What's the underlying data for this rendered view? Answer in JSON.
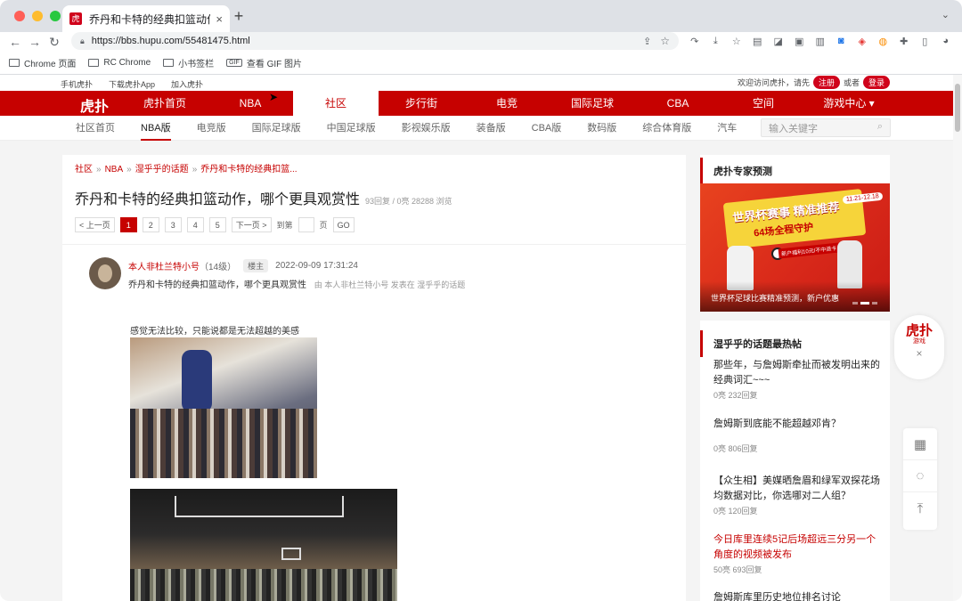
{
  "browser": {
    "tab_title": "乔丹和卡特的经典扣篮动作，",
    "tab_favicon": "虎扑",
    "url": "https://bbs.hupu.com/55481475.html",
    "bookmarks": [
      {
        "label": "Chrome 页面"
      },
      {
        "label": "RC Chrome"
      },
      {
        "label": "小书签栏"
      },
      {
        "label": "查看 GIF 图片",
        "badge": "GIF"
      }
    ]
  },
  "topstrip": {
    "links": [
      "手机虎扑",
      "下载虎扑App",
      "加入虎扑"
    ],
    "welcome": "欢迎访问虎扑，请先",
    "register": "注册",
    "or": "或者",
    "login": "登录"
  },
  "mainnav": {
    "logo": "虎扑",
    "items": [
      "虎扑首页",
      "NBA",
      "社区",
      "步行街",
      "电竞",
      "国际足球",
      "CBA",
      "空间",
      "游戏中心 ▾"
    ],
    "active": "社区"
  },
  "subnav": {
    "items": [
      "社区首页",
      "NBA版",
      "电竞版",
      "国际足球版",
      "中国足球版",
      "影视娱乐版",
      "装备版",
      "CBA版",
      "数码版",
      "综合体育版",
      "汽车"
    ],
    "active": "NBA版",
    "search_placeholder": "输入关键字"
  },
  "thread": {
    "breadcrumb": [
      "社区",
      "NBA",
      "湿乎乎的话题",
      "乔丹和卡特的经典扣篮..."
    ],
    "title": "乔丹和卡特的经典扣篮动作，哪个更具观赏性",
    "meta": "93回复 / 0亮 28288 浏览",
    "pager": {
      "prev": "< 上一页",
      "pages": [
        "1",
        "2",
        "3",
        "4",
        "5"
      ],
      "current": "1",
      "next": "下一页 >",
      "goto": "到第",
      "page_unit": "页",
      "go": "GO"
    },
    "post": {
      "username": "本人非杜兰特小号",
      "level": "（14级）",
      "badge": "楼主",
      "time": "2022-09-09 17:31:24",
      "subject": "乔丹和卡特的经典扣篮动作，哪个更具观赏性",
      "from": "由  本人非杜兰特小号  发表在  湿乎乎的话题",
      "body": "感觉无法比较，只能说都是无法超越的美感"
    }
  },
  "sidebar": {
    "expert_title": "虎扑专家预测",
    "promo": {
      "headline": "世界杯赛事 精准推荐",
      "sub": "64场全程守护",
      "date": "11.21-12.18",
      "small": "新户福利10元/不中退卡",
      "caption": "世界杯足球比赛精准预测，新户优惠"
    },
    "hot_title": "湿乎乎的话题最热帖",
    "hot": [
      {
        "title": "那些年，与詹姆斯牵扯而被发明出来的经典词汇~~~",
        "meta": "0亮 232回复",
        "red": false
      },
      {
        "title": "詹姆斯到底能不能超越邓肯？",
        "meta": "0亮 806回复",
        "red": false
      },
      {
        "title": "【众生相】美媒晒詹眉和绿军双探花场均数据对比，你选哪对二人组？",
        "meta": "0亮 120回复",
        "red": false
      },
      {
        "title": "今日库里连续5记后场超远三分另一个角度的视频被发布",
        "meta": "50亮 693回复",
        "red": true
      },
      {
        "title": "詹姆斯库里历史地位排名讨论",
        "meta": "",
        "red": false
      }
    ]
  },
  "float": {
    "logo": "虎扑",
    "logo_sub": "游戏",
    "close": "×"
  },
  "colors": {
    "brand": "#c60100",
    "accent": "#d0021b"
  }
}
